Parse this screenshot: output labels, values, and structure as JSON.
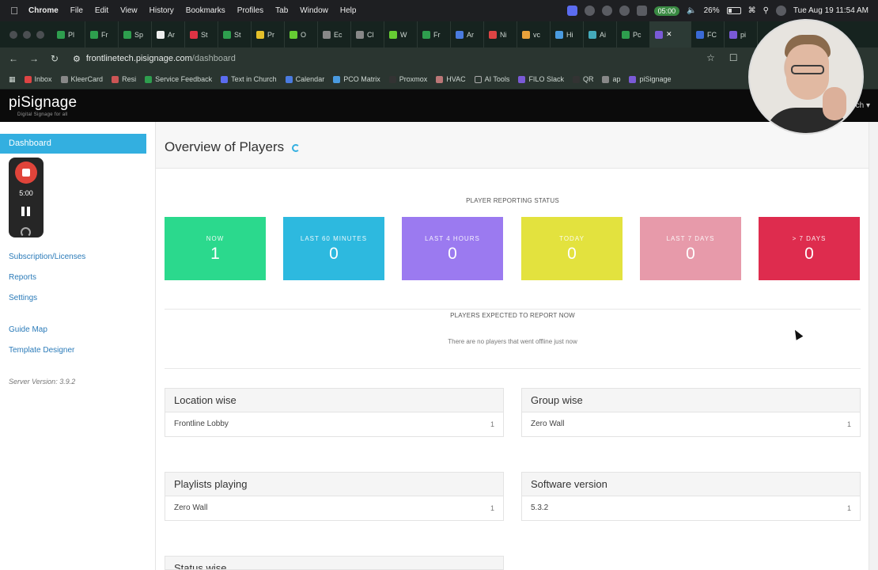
{
  "menubar": {
    "app": "Chrome",
    "items": [
      "File",
      "Edit",
      "View",
      "History",
      "Bookmarks",
      "Profiles",
      "Tab",
      "Window",
      "Help"
    ],
    "timer": "05:00",
    "battery": "26%",
    "clock": "Tue Aug 19  11:54 AM"
  },
  "tabs": [
    "Pl",
    "Fr",
    "Sp",
    "Ar",
    "St",
    "St",
    "Pr",
    "O",
    "Ec",
    "Cl",
    "W",
    "Fr",
    "Ar",
    "Ni",
    "vc",
    "Hi",
    "Ai",
    "Pc",
    "",
    "FC",
    "pi"
  ],
  "address": {
    "host": "frontlinetech.pisignage.com",
    "path": "/dashboard"
  },
  "bookmarks": [
    "Inbox",
    "KleerCard",
    "Resi",
    "Service Feedback",
    "Text in Church",
    "Calendar",
    "PCO Matrix",
    "Proxmox",
    "HVAC",
    "AI Tools",
    "FILO Slack",
    "QR",
    "ap",
    "piSignage"
  ],
  "app": {
    "logo": "piSignage",
    "tagline": "Digital Signage for all",
    "user_menu": "ch ▾"
  },
  "sidebar": {
    "active": "Dashboard",
    "recorder_time": "5:00",
    "links": [
      "Subscription/Licenses",
      "Reports",
      "Settings",
      "Guide Map",
      "Template Designer"
    ],
    "server_version": "Server Version: 3.9.2"
  },
  "main": {
    "title": "Overview of Players",
    "reporting_caption": "PLAYER REPORTING STATUS",
    "stats": [
      {
        "label": "NOW",
        "value": "1",
        "color": "#2bd98d"
      },
      {
        "label": "LAST 60 MINUTES",
        "value": "0",
        "color": "#2db9df"
      },
      {
        "label": "LAST 4 HOURS",
        "value": "0",
        "color": "#9b7af0"
      },
      {
        "label": "TODAY",
        "value": "0",
        "color": "#e3e23e"
      },
      {
        "label": "LAST 7 DAYS",
        "value": "0",
        "color": "#e79aaa"
      },
      {
        "label": "> 7 DAYS",
        "value": "0",
        "color": "#de2c4e"
      }
    ],
    "expected_caption": "PLAYERS EXPECTED TO REPORT NOW",
    "no_players": "There are no players that went offline just now",
    "panels": [
      {
        "title": "Location wise",
        "row": "Frontline Lobby",
        "count": "1"
      },
      {
        "title": "Group wise",
        "row": "Zero Wall",
        "count": "1"
      },
      {
        "title": "Playlists playing",
        "row": "Zero Wall",
        "count": "1"
      },
      {
        "title": "Software version",
        "row": "5.3.2",
        "count": "1"
      },
      {
        "title": "Status wise",
        "row": "",
        "count": ""
      }
    ]
  }
}
